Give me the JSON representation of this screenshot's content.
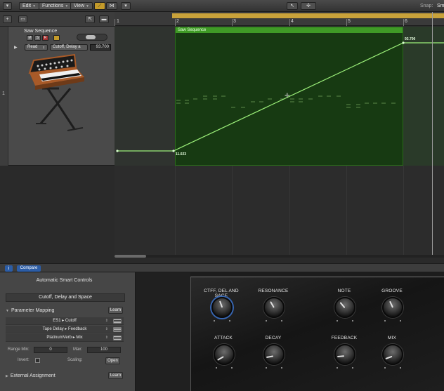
{
  "toolbar": {
    "edit": "Edit",
    "functions": "Functions",
    "view": "View",
    "snap_label": "Snap:",
    "snap_value": "Sm"
  },
  "ruler": {
    "bars": [
      "1",
      "2",
      "3",
      "4",
      "5",
      "6"
    ]
  },
  "track": {
    "number": "1",
    "name": "Saw Sequence",
    "mute": "M",
    "solo": "S",
    "record": "R",
    "automation_mode": "Read",
    "automation_param": "Cutoff, Delay a",
    "automation_value": "93.700"
  },
  "region": {
    "name": "Saw Sequence",
    "start_value": "11.023",
    "end_value": "93.700"
  },
  "smart_controls": {
    "info_label": "i",
    "compare_label": "Compare",
    "title": "Automatic Smart Controls",
    "control_name": "Cutoff, Delay and Space",
    "parameter_mapping": "Parameter Mapping",
    "learn": "Learn",
    "mappings": [
      {
        "label": "ES1 ▸ Cutoff"
      },
      {
        "label": "Tape Delay ▸ Feedback"
      },
      {
        "label": "PlatinumVerb ▸ Mix"
      }
    ],
    "range_min_label": "Range Min:",
    "range_min": "0",
    "max_label": "Max:",
    "max": "100",
    "invert_label": "Invert:",
    "scaling_label": "Scaling:",
    "open": "Open",
    "external_assignment": "External Assignment",
    "learn2": "Learn"
  },
  "knobs": [
    {
      "label": "CTFF, DEL AND SACE",
      "active": true
    },
    {
      "label": "RESONANCE"
    },
    {
      "label": "NOTE"
    },
    {
      "label": "GROOVE"
    },
    {
      "label": "ATTACK"
    },
    {
      "label": "DECAY"
    },
    {
      "label": "FEEDBACK"
    },
    {
      "label": "MIX"
    }
  ],
  "colors": {
    "region_bg": "#173a12",
    "region_header": "#3f9a26",
    "automation_line": "#9cf07a",
    "cycle": "#c9a23a",
    "compare_blue": "#2c5da6"
  }
}
